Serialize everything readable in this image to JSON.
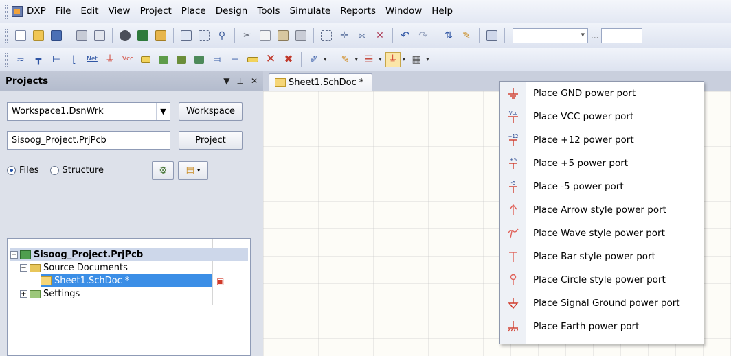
{
  "menubar": {
    "items": [
      {
        "label": "DXP"
      },
      {
        "label": "File"
      },
      {
        "label": "Edit"
      },
      {
        "label": "View"
      },
      {
        "label": "Project"
      },
      {
        "label": "Place"
      },
      {
        "label": "Design"
      },
      {
        "label": "Tools"
      },
      {
        "label": "Simulate"
      },
      {
        "label": "Reports"
      },
      {
        "label": "Window"
      },
      {
        "label": "Help"
      }
    ]
  },
  "projects_panel": {
    "title": "Projects",
    "workspace_combo_value": "Workspace1.DsnWrk",
    "workspace_button": "Workspace",
    "project_field_value": "Sisoog_Project.PrjPcb",
    "project_button": "Project",
    "radio_files": "Files",
    "radio_structure": "Structure",
    "tree": {
      "project": "Sisoog_Project.PrjPcb",
      "source_documents": "Source Documents",
      "sheet": "Sheet1.SchDoc *",
      "settings": "Settings"
    }
  },
  "document_tab": {
    "label": "Sheet1.SchDoc *"
  },
  "power_port_menu": {
    "items": [
      {
        "label": "Place GND power port",
        "icon": "gnd-icon"
      },
      {
        "label": "Place VCC power port",
        "icon": "vcc-icon"
      },
      {
        "label": "Place +12 power port",
        "icon": "plus12-icon"
      },
      {
        "label": "Place +5 power port",
        "icon": "plus5-icon"
      },
      {
        "label": "Place -5 power port",
        "icon": "minus5-icon"
      },
      {
        "label": "Place Arrow style power port",
        "icon": "arrow-port-icon"
      },
      {
        "label": "Place Wave style power port",
        "icon": "wave-port-icon"
      },
      {
        "label": "Place Bar style power port",
        "icon": "bar-port-icon"
      },
      {
        "label": "Place Circle style power port",
        "icon": "circle-port-icon"
      },
      {
        "label": "Place Signal Ground power port",
        "icon": "signal-ground-icon"
      },
      {
        "label": "Place Earth power port",
        "icon": "earth-icon"
      }
    ],
    "icon_text": {
      "vcc": "Vcc",
      "p12": "+12",
      "p5": "+5",
      "m5": "-5"
    },
    "colors": {
      "port_red": "#d03a2a",
      "port_red_light": "#e0625a"
    }
  },
  "colors": {
    "menubar_bg": "#e9edf6",
    "panel_bg": "#c9cfdd",
    "selection": "#3b8ee6",
    "canvas": "#fdfcf7"
  }
}
